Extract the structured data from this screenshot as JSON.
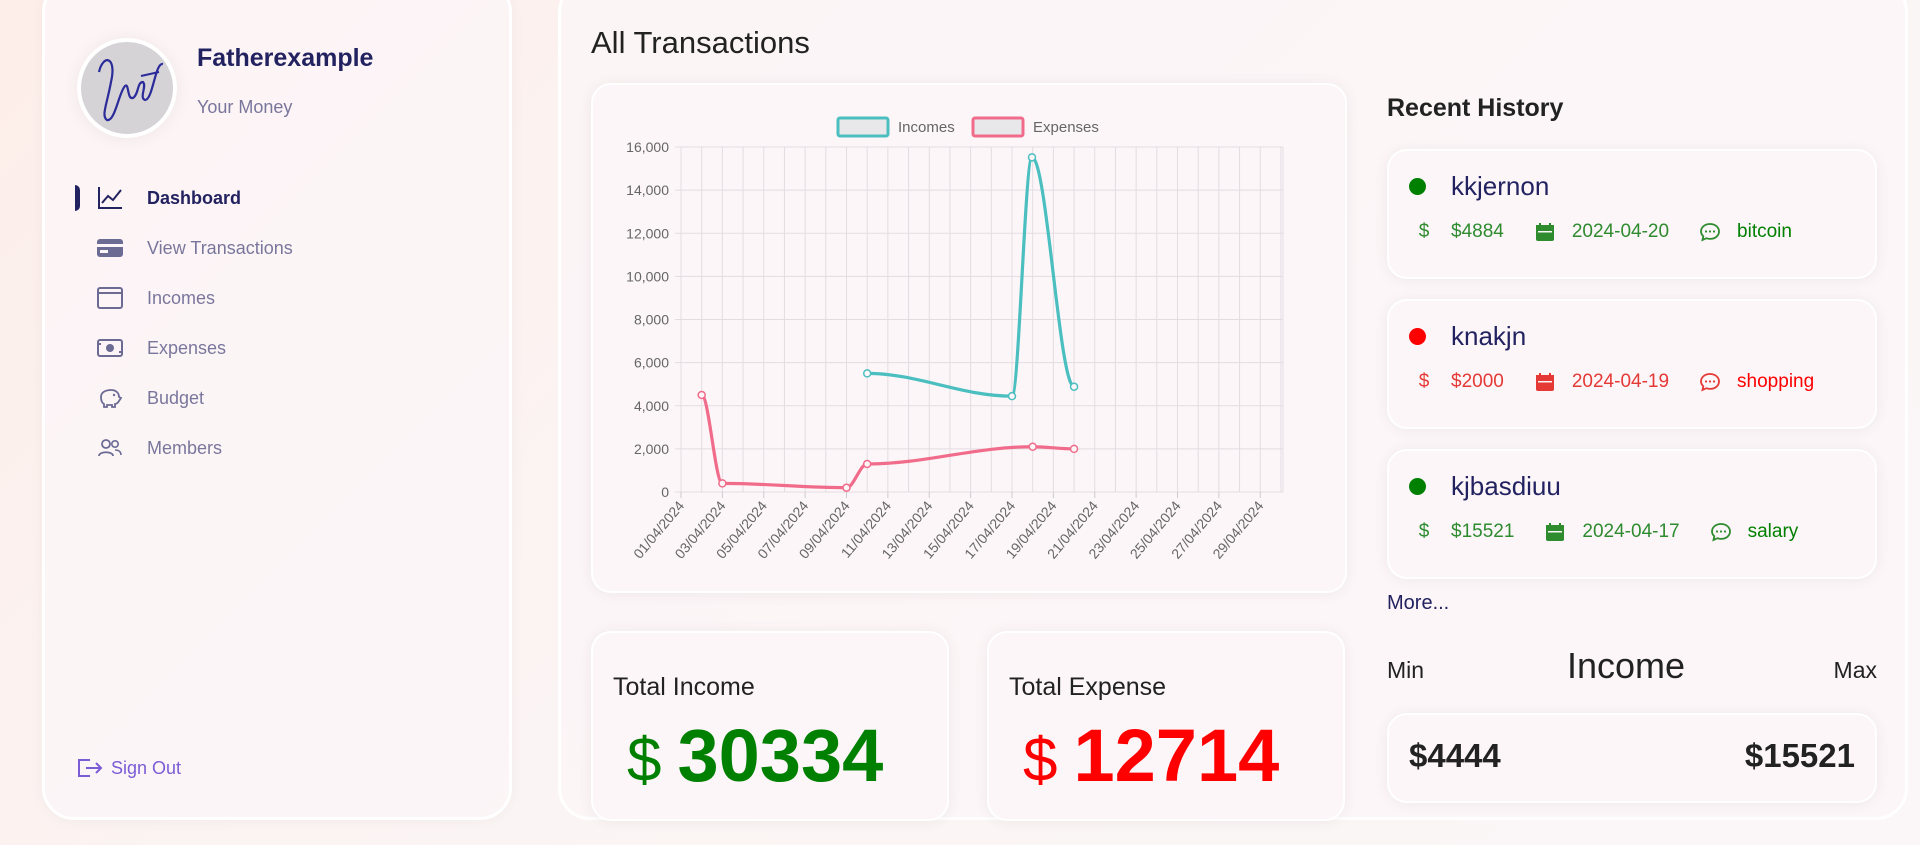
{
  "profile": {
    "name": "Fatherexample",
    "subtitle": "Your Money",
    "avatar_text": "Jay"
  },
  "menu": [
    {
      "label": "Dashboard",
      "icon": "line-chart-icon",
      "active": true
    },
    {
      "label": "View Transactions",
      "icon": "credit-card-icon",
      "active": false
    },
    {
      "label": "Incomes",
      "icon": "window-icon",
      "active": false
    },
    {
      "label": "Expenses",
      "icon": "money-icon",
      "active": false
    },
    {
      "label": "Budget",
      "icon": "piggy-bank-icon",
      "active": false
    },
    {
      "label": "Members",
      "icon": "users-icon",
      "active": false
    }
  ],
  "signout_label": "Sign Out",
  "page_title": "All Transactions",
  "chart_data": {
    "type": "line",
    "title": "",
    "xlabel": "",
    "ylabel": "",
    "ylim": [
      0,
      16000
    ],
    "yticks": [
      "0",
      "2,000",
      "4,000",
      "6,000",
      "8,000",
      "10,000",
      "12,000",
      "14,000",
      "16,000"
    ],
    "xticks": [
      "01/04/2024",
      "03/04/2024",
      "05/04/2024",
      "07/04/2024",
      "09/04/2024",
      "11/04/2024",
      "13/04/2024",
      "15/04/2024",
      "17/04/2024",
      "19/04/2024",
      "21/04/2024",
      "23/04/2024",
      "25/04/2024",
      "27/04/2024",
      "29/04/2024"
    ],
    "legend_position": "top-center",
    "grid": true,
    "series": [
      {
        "name": "Incomes",
        "color": "#4bbfc0",
        "points": [
          [
            "10/04/2024",
            5500
          ],
          [
            "17/04/2024",
            4444
          ],
          [
            "17/04/2024",
            15521
          ],
          [
            "20/04/2024",
            4884
          ]
        ]
      },
      {
        "name": "Expenses",
        "color": "#f06c8a",
        "points": [
          [
            "02/04/2024",
            4500
          ],
          [
            "03/04/2024",
            400
          ],
          [
            "09/04/2024",
            200
          ],
          [
            "10/04/2024",
            1300
          ],
          [
            "18/04/2024",
            2100
          ],
          [
            "20/04/2024",
            2000
          ]
        ]
      }
    ]
  },
  "total_income": {
    "label": "Total Income",
    "currency": "$",
    "value": "30334",
    "color": "#008000"
  },
  "total_expense": {
    "label": "Total Expense",
    "currency": "$",
    "value": "12714",
    "color": "#ff0000"
  },
  "history": {
    "title": "Recent History",
    "items": [
      {
        "name": "kkjernon",
        "amount": "$4884",
        "date": "2024-04-20",
        "note": "bitcoin",
        "type": "income",
        "color": "#008000",
        "meta_color": "#2e8b2e"
      },
      {
        "name": "knakjn",
        "amount": "$2000",
        "date": "2024-04-19",
        "note": "shopping",
        "type": "expense",
        "color": "#ff0000",
        "meta_color": "#e53935"
      },
      {
        "name": "kjbasdiuu",
        "amount": "$15521",
        "date": "2024-04-17",
        "note": "salary",
        "type": "income",
        "color": "#008000",
        "meta_color": "#2e8b2e"
      }
    ],
    "more_label": "More..."
  },
  "minmax": {
    "min_label": "Min",
    "title": "Income",
    "max_label": "Max",
    "min_value": "$4444",
    "max_value": "$15521"
  }
}
